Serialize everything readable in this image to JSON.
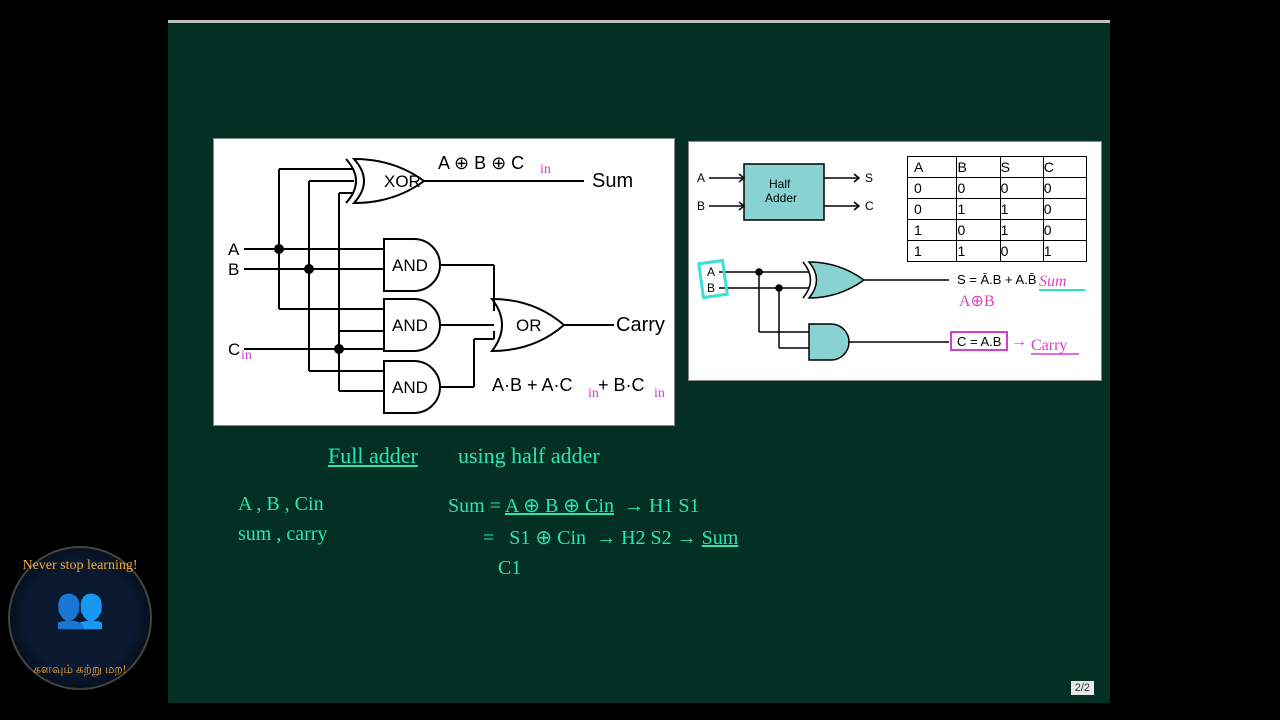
{
  "page_indicator": "2/2",
  "logo": {
    "top": "Never stop learning!",
    "bottom": "களவும் கற்று மற!"
  },
  "full_adder": {
    "xor_label": "XOR",
    "and_label": "AND",
    "or_label": "OR",
    "inA": "A",
    "inB": "B",
    "inC": "C",
    "cin_sub": "in",
    "xor_out": "A ⊕ B ⊕ C",
    "sum": "Sum",
    "carry": "Carry",
    "carry_eq": "A·B + A·C",
    "carry_eq2": "+ B·C"
  },
  "half_adder": {
    "block_l1": "Half",
    "block_l2": "Adder",
    "inA": "A",
    "inB": "B",
    "outS": "S",
    "outC": "C",
    "s_eq": "S = Ā.B + A.B̄",
    "c_eq": "C = A.B",
    "ann_xor": "A⊕B",
    "ann_sum": "Sum",
    "ann_carry": "Carry"
  },
  "truth_table": {
    "headers": [
      "A",
      "B",
      "S",
      "C"
    ],
    "rows": [
      [
        "0",
        "0",
        "0",
        "0"
      ],
      [
        "0",
        "1",
        "1",
        "0"
      ],
      [
        "1",
        "0",
        "1",
        "0"
      ],
      [
        "1",
        "1",
        "0",
        "1"
      ]
    ]
  },
  "notes": {
    "title": "Full adder",
    "title2": "using  half adder",
    "l1": "A , B , Cin",
    "l2": "sum , carry",
    "eq1a": "Sum = ",
    "eq1b": "A ⊕ B ⊕ Cin",
    "eq1c": "→ H1  S1",
    "eq2a": "= ",
    "eq2b": "S1 ⊕ Cin",
    "eq2c": "→ H2  S2  →",
    "eq2d": "Sum",
    "c1": "C1"
  }
}
